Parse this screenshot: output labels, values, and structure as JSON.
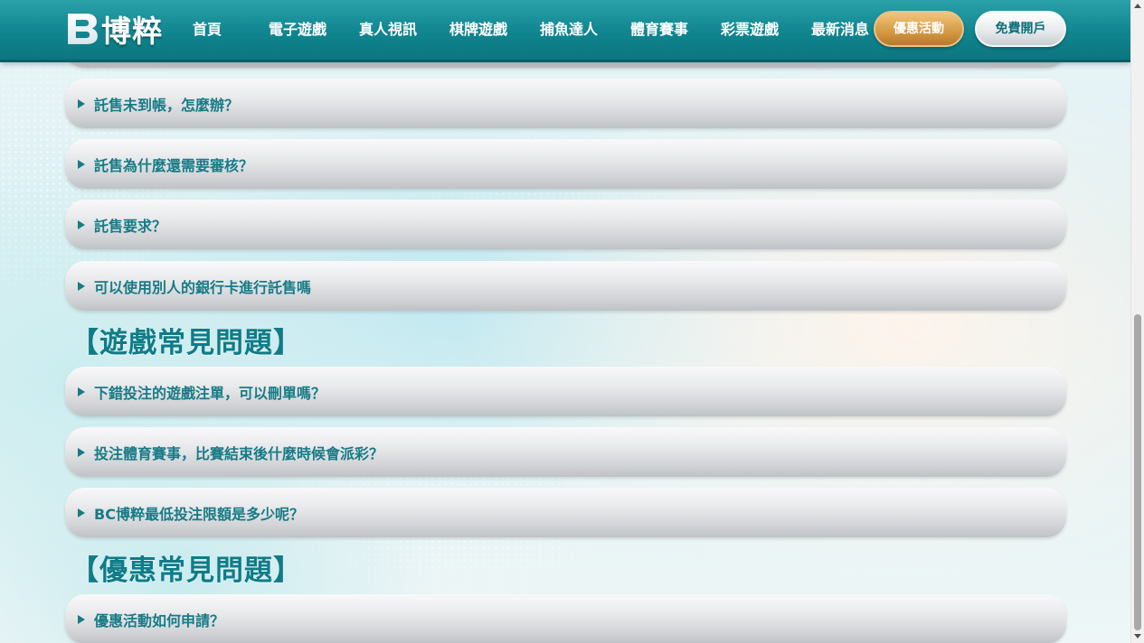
{
  "header": {
    "logo_text": "博粹",
    "nav": [
      "首頁",
      "電子遊戲",
      "真人視訊",
      "棋牌遊戲",
      "捕魚達人",
      "體育賽事",
      "彩票遊戲",
      "最新消息"
    ],
    "promo_button": "優惠活動",
    "signup_button": "免費開戶"
  },
  "faq": {
    "items_top": [
      "託售未到帳，怎麼辦？",
      "託售為什麼還需要審核？",
      "託售要求？",
      "可以使用別人的銀行卡進行託售嗎"
    ],
    "game_section_title": "【遊戲常見問題】",
    "game_items": [
      "下錯投注的遊戲注單，可以刪單嗎？",
      "投注體育賽事，比賽結束後什麼時候會派彩？",
      "BC博粹最低投注限額是多少呢？"
    ],
    "promo_section_title": "【優惠常見問題】",
    "promo_items": [
      "優惠活動如何申請？"
    ]
  },
  "colors": {
    "header": "#10858f",
    "accent_text": "#177b86",
    "promo_gold": "#d79b45"
  }
}
